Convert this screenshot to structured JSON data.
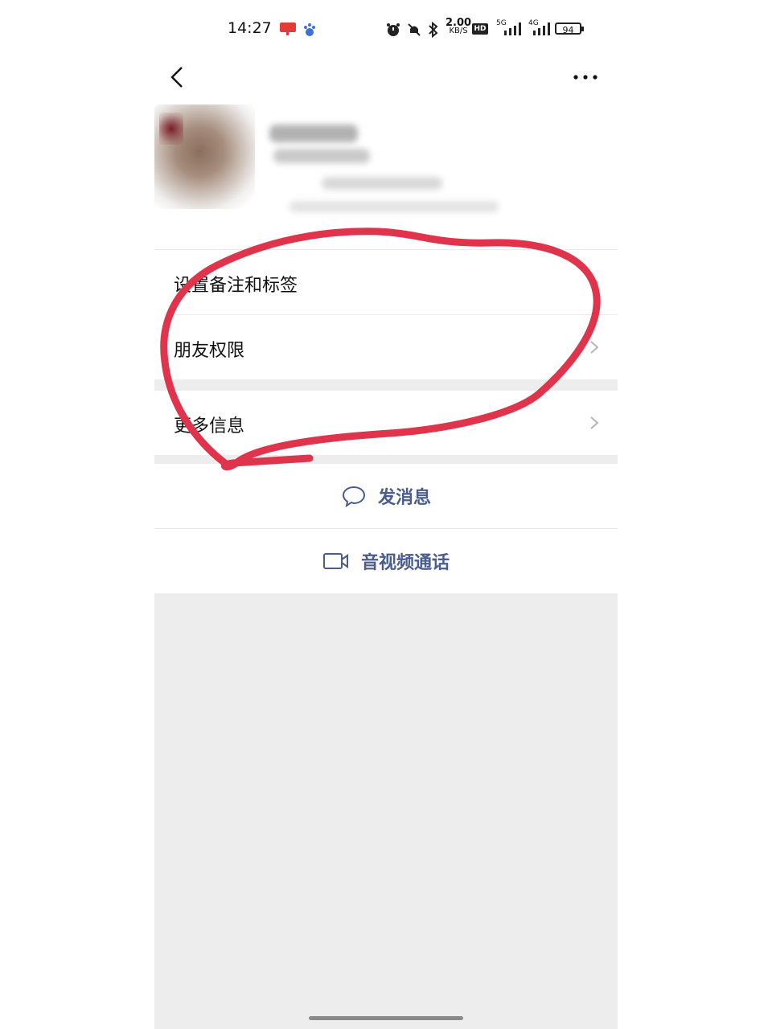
{
  "status_bar": {
    "time": "14:27",
    "speed_value": "2.00",
    "speed_unit": "KB/S",
    "hd": "HD",
    "net1": "5G",
    "net2": "4G",
    "battery": "94"
  },
  "menu": {
    "remark_label": "设置备注和标签",
    "permission_label": "朋友权限",
    "more_info_label": "更多信息"
  },
  "actions": {
    "message_label": "发消息",
    "call_label": "音视频通话"
  },
  "colors": {
    "action_text": "#4a5d8f",
    "annotation": "#e0344c",
    "background_gray": "#ededed"
  },
  "icons": [
    "back-icon",
    "more-icon",
    "chevron-right-icon",
    "chat-bubble-icon",
    "video-icon",
    "alarm-icon",
    "mute-icon",
    "bluetooth-icon"
  ]
}
